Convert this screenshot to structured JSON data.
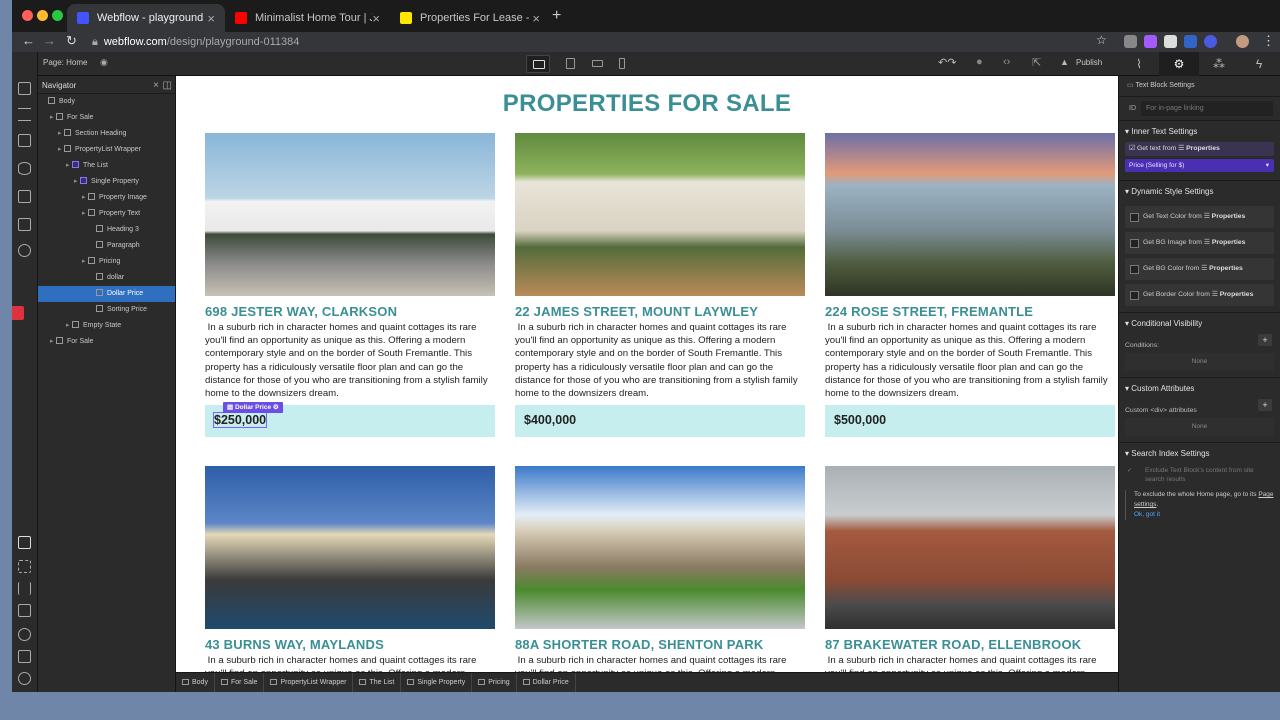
{
  "browser": {
    "tabs": [
      {
        "title": "Webflow - playground",
        "color": "#4353ff"
      },
      {
        "title": "Minimalist Home Tour | Joshua",
        "color": "#ff0000"
      },
      {
        "title": "Properties For Lease - Ray Whi",
        "color": "#ffe600"
      }
    ],
    "url_host": "webflow.com",
    "url_path": "/design/playground-011384"
  },
  "topbar": {
    "page_label": "Page: Home",
    "publish": "Publish"
  },
  "navigator": {
    "title": "Navigator",
    "items": [
      {
        "label": "Body",
        "depth": 0
      },
      {
        "label": "For Sale",
        "depth": 1
      },
      {
        "label": "Section Heading",
        "depth": 2
      },
      {
        "label": "PropertyList Wrapper",
        "depth": 2
      },
      {
        "label": "The List",
        "depth": 3
      },
      {
        "label": "Single Property",
        "depth": 4
      },
      {
        "label": "Property Image",
        "depth": 5
      },
      {
        "label": "Property Text",
        "depth": 5
      },
      {
        "label": "Heading 3",
        "depth": 6
      },
      {
        "label": "Paragraph",
        "depth": 6
      },
      {
        "label": "Pricing",
        "depth": 5
      },
      {
        "label": "dollar",
        "depth": 6
      },
      {
        "label": "Dollar Price",
        "depth": 6
      },
      {
        "label": "Sorting Price",
        "depth": 6
      },
      {
        "label": "Empty State",
        "depth": 3
      },
      {
        "label": "For Sale",
        "depth": 1
      }
    ]
  },
  "canvas": {
    "heading": "PROPERTIES FOR SALE",
    "description": "In a suburb rich in character homes and quaint cottages its rare you'll find an opportunity as unique as this. Offering a modern contemporary style and on the border of South Fremantle. This property has a ridiculously versatile floor plan and can go the distance for those of you who are transitioning from a stylish family home to the downsizers dream.",
    "selected_tag": "Dollar Price",
    "properties": [
      {
        "title": "698 JESTER WAY, CLARKSON",
        "price": "$250,000"
      },
      {
        "title": "22 JAMES STREET, MOUNT LAYWLEY",
        "price": "$400,000"
      },
      {
        "title": "224 ROSE STREET, FREMANTLE",
        "price": "$500,000"
      },
      {
        "title": "43 BURNS WAY, MAYLANDS",
        "price": ""
      },
      {
        "title": "88A SHORTER ROAD, SHENTON PARK",
        "price": ""
      },
      {
        "title": "87 BRAKEWATER ROAD, ELLENBROOK",
        "price": ""
      }
    ]
  },
  "settings": {
    "header": "Text Block Settings",
    "id_label": "ID",
    "id_placeholder": "For in-page linking",
    "inner_text": "Inner Text Settings",
    "get_text": "Get text from",
    "properties": "Properties",
    "price_field": "Price (Selling for $)",
    "dynamic": "Dynamic Style Settings",
    "dyn_items": [
      "Get Text Color from",
      "Get BG Image from",
      "Get BG Color from",
      "Get Border Color from"
    ],
    "conditional": "Conditional Visibility",
    "conditions": "Conditions:",
    "none": "None",
    "custom_attr": "Custom Attributes",
    "custom_div": "Custom <div> attributes",
    "search_index": "Search Index Settings",
    "exclude": "Exclude Text Block's content from site search results",
    "exclude_note": "To exclude the whole Home page, go to its",
    "page_settings": "Page settings",
    "ok": "Ok, got it"
  },
  "breadcrumb": [
    "Body",
    "For Sale",
    "PropertyList Wrapper",
    "The List",
    "Single Property",
    "Pricing",
    "Dollar Price"
  ]
}
